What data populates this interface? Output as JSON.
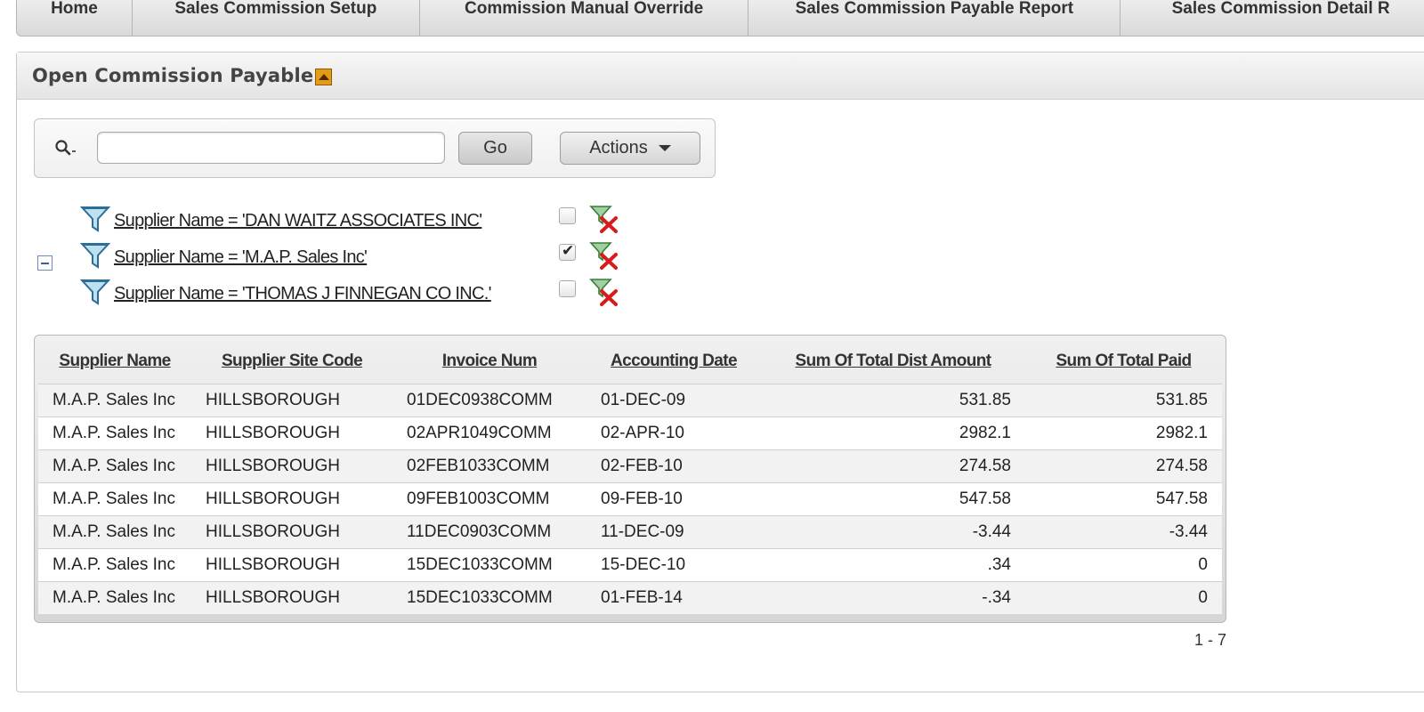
{
  "tabs": [
    {
      "label": "Home",
      "width": 130
    },
    {
      "label": "Sales Commission Setup",
      "width": 323
    },
    {
      "label": "Commission Manual Override",
      "width": 370
    },
    {
      "label": "Sales Commission Payable Report",
      "width": 418
    },
    {
      "label": "Sales Commission Detail R",
      "width": 360
    }
  ],
  "region": {
    "title": "Open Commission Payable"
  },
  "search": {
    "value": "",
    "go_label": "Go",
    "actions_label": "Actions"
  },
  "filters": [
    {
      "text": "Supplier Name = 'DAN WAITZ ASSOCIATES INC'",
      "checked": false
    },
    {
      "text": "Supplier Name = 'M.A.P. Sales Inc'",
      "checked": true
    },
    {
      "text": "Supplier Name = 'THOMAS J FINNEGAN CO INC.'",
      "checked": false
    }
  ],
  "table": {
    "columns": [
      "Supplier Name",
      "Supplier Site Code",
      "Invoice Num",
      "Accounting Date",
      "Sum Of Total Dist Amount",
      "Sum Of Total Paid"
    ],
    "rows": [
      [
        "M.A.P. Sales Inc",
        "HILLSBOROUGH",
        "01DEC0938COMM",
        "01-DEC-09",
        "531.85",
        "531.85"
      ],
      [
        "M.A.P. Sales Inc",
        "HILLSBOROUGH",
        "02APR1049COMM",
        "02-APR-10",
        "2982.1",
        "2982.1"
      ],
      [
        "M.A.P. Sales Inc",
        "HILLSBOROUGH",
        "02FEB1033COMM",
        "02-FEB-10",
        "274.58",
        "274.58"
      ],
      [
        "M.A.P. Sales Inc",
        "HILLSBOROUGH",
        "09FEB1003COMM",
        "09-FEB-10",
        "547.58",
        "547.58"
      ],
      [
        "M.A.P. Sales Inc",
        "HILLSBOROUGH",
        "11DEC0903COMM",
        "11-DEC-09",
        "-3.44",
        "-3.44"
      ],
      [
        "M.A.P. Sales Inc",
        "HILLSBOROUGH",
        "15DEC1033COMM",
        "15-DEC-10",
        ".34",
        "0"
      ],
      [
        "M.A.P. Sales Inc",
        "HILLSBOROUGH",
        "15DEC1033COMM",
        "01-FEB-14",
        "-.34",
        "0"
      ]
    ]
  },
  "pagination": "1 - 7"
}
